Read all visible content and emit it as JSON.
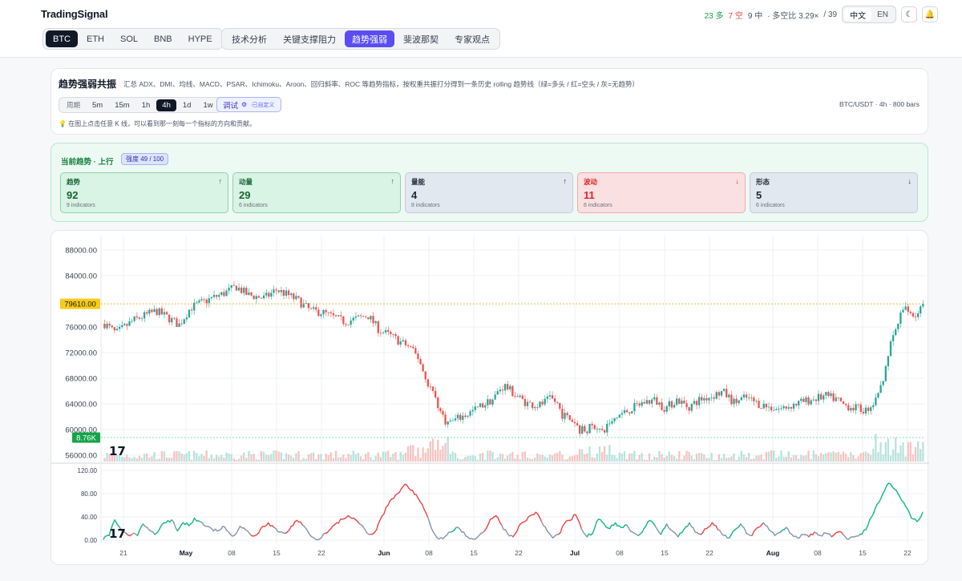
{
  "header": {
    "brand": "TradingSignal",
    "coins": [
      "BTC",
      "ETH",
      "SOL",
      "BNB",
      "HYPE"
    ],
    "active_coin": 0,
    "tabs": [
      "技术分析",
      "关键支撑阻力",
      "趋势强弱",
      "斐波那契",
      "专家观点"
    ],
    "active_tab": 2,
    "stats": {
      "bull": "23 多",
      "bear": "7 空",
      "neutral": "9 中",
      "ratio": "· 多空比 3.29×",
      "total": "/ 39"
    },
    "lang": [
      "中文",
      "EN"
    ],
    "icons": {
      "theme": "moon-icon",
      "alerts": "bell-icon"
    }
  },
  "info": {
    "title": "趋势强弱共振",
    "description": "汇总 ADX、DMI、均线、MACD、PSAR、Ichimoku、Aroon、回归斜率、ROC 等趋势指标，按权重共振打分得到一条历史 rolling 趋势线（绿=多头 / 红=空头 / 灰=无趋势）",
    "period_label": "周期",
    "timeframes": [
      "5m",
      "15m",
      "1h",
      "4h",
      "1d",
      "1w"
    ],
    "active_timeframe": 3,
    "debug_label": "调试",
    "debug_note": "·已自定义",
    "pair_info": "BTC/USDT · 4h · 800 bars",
    "hint": "💡 在图上点击任意 K 线，可以看到那一刻每一个指标的方向和贡献。"
  },
  "trend": {
    "title": "当前趋势 · 上行",
    "strength": "强度 49 / 100",
    "metrics": [
      {
        "name": "趋势",
        "value": "92",
        "sub": "9 indicators",
        "arrow": "↑",
        "tone": "green"
      },
      {
        "name": "动量",
        "value": "29",
        "sub": "6 indicators",
        "arrow": "↑",
        "tone": "green"
      },
      {
        "name": "量能",
        "value": "4",
        "sub": "8 indicators",
        "arrow": "↑",
        "tone": "gray"
      },
      {
        "name": "波动",
        "value": "11",
        "sub": "6 indicators",
        "arrow": "↓",
        "tone": "red"
      },
      {
        "name": "形态",
        "value": "5",
        "sub": "6 indicators",
        "arrow": "↓",
        "tone": "gray"
      }
    ]
  },
  "chart_data": {
    "type": "candlestick",
    "price_axis": {
      "ticks": [
        "88000.00",
        "84000.00",
        "76000.00",
        "72000.00",
        "68000.00",
        "64000.00",
        "60000.00",
        "56000.00"
      ],
      "range": [
        55000,
        89500
      ]
    },
    "last_price_label": "79610.00",
    "last_price": 79610,
    "volume_label": "8.76K",
    "indicator_axis": {
      "ticks": [
        "120.00",
        "80.00",
        "40.00",
        "0.00"
      ],
      "range": [
        -8,
        128
      ]
    },
    "x_ticks": [
      "21",
      "May",
      "08",
      "15",
      "22",
      "Jun",
      "08",
      "15",
      "22",
      "Jul",
      "08",
      "15",
      "22",
      "Aug",
      "08",
      "15",
      "22"
    ],
    "price_path": [
      [
        0,
        76500
      ],
      [
        2,
        75000
      ],
      [
        5,
        77000
      ],
      [
        9,
        78500
      ],
      [
        11,
        77500
      ],
      [
        13,
        76300
      ],
      [
        15,
        79000
      ],
      [
        18,
        80200
      ],
      [
        21,
        81300
      ],
      [
        23,
        82300
      ],
      [
        25,
        81000
      ],
      [
        28,
        80500
      ],
      [
        30,
        81800
      ],
      [
        32,
        81000
      ],
      [
        34,
        80000
      ],
      [
        36,
        78500
      ],
      [
        38,
        78300
      ],
      [
        40,
        77500
      ],
      [
        42,
        76800
      ],
      [
        44,
        77300
      ],
      [
        46,
        77800
      ],
      [
        48,
        75500
      ],
      [
        50,
        74600
      ],
      [
        52,
        73500
      ],
      [
        53,
        73000
      ],
      [
        55,
        71000
      ],
      [
        56,
        68000
      ],
      [
        57,
        66500
      ],
      [
        58,
        64500
      ],
      [
        59,
        62000
      ],
      [
        60,
        61000
      ],
      [
        62,
        61800
      ],
      [
        64,
        62700
      ],
      [
        66,
        63800
      ],
      [
        68,
        64800
      ],
      [
        69,
        66300
      ],
      [
        70,
        66800
      ],
      [
        72,
        65200
      ],
      [
        74,
        64000
      ],
      [
        76,
        63800
      ],
      [
        78,
        64800
      ],
      [
        79,
        64200
      ],
      [
        80,
        62300
      ],
      [
        82,
        61300
      ],
      [
        83,
        60000
      ],
      [
        84,
        60000
      ],
      [
        86,
        60700
      ],
      [
        87,
        59200
      ],
      [
        88,
        61000
      ],
      [
        90,
        62300
      ],
      [
        92,
        63200
      ],
      [
        94,
        64200
      ],
      [
        96,
        64600
      ],
      [
        98,
        63300
      ],
      [
        100,
        64700
      ],
      [
        102,
        63500
      ],
      [
        104,
        64700
      ],
      [
        106,
        65200
      ],
      [
        108,
        65900
      ],
      [
        110,
        64200
      ],
      [
        112,
        65000
      ],
      [
        114,
        64100
      ],
      [
        116,
        63500
      ],
      [
        118,
        63200
      ],
      [
        120,
        63800
      ],
      [
        122,
        64300
      ],
      [
        124,
        64800
      ],
      [
        126,
        65200
      ],
      [
        128,
        64700
      ],
      [
        129,
        63900
      ],
      [
        131,
        63400
      ],
      [
        133,
        63000
      ],
      [
        134,
        63900
      ],
      [
        135,
        64600
      ],
      [
        136,
        68000
      ],
      [
        137,
        72200
      ],
      [
        138,
        75000
      ],
      [
        139,
        77500
      ],
      [
        140,
        79300
      ],
      [
        141,
        78000
      ],
      [
        142,
        77800
      ],
      [
        143,
        79610
      ]
    ],
    "indicator_path": [
      [
        0,
        2,
        "gray"
      ],
      [
        1,
        8,
        "green"
      ],
      [
        2,
        35,
        "green"
      ],
      [
        3,
        20,
        "green"
      ],
      [
        4,
        12,
        "gray"
      ],
      [
        5,
        10,
        "red"
      ],
      [
        6,
        8,
        "gray"
      ],
      [
        7,
        28,
        "green"
      ],
      [
        8,
        18,
        "gray"
      ],
      [
        9,
        10,
        "gray"
      ],
      [
        10,
        22,
        "green"
      ],
      [
        11,
        30,
        "green"
      ],
      [
        12,
        35,
        "green"
      ],
      [
        13,
        16,
        "gray"
      ],
      [
        14,
        30,
        "green"
      ],
      [
        15,
        25,
        "green"
      ],
      [
        16,
        38,
        "green"
      ],
      [
        17,
        32,
        "green"
      ],
      [
        18,
        24,
        "gray"
      ],
      [
        19,
        20,
        "gray"
      ],
      [
        20,
        16,
        "gray"
      ],
      [
        21,
        24,
        "gray"
      ],
      [
        22,
        14,
        "gray"
      ],
      [
        23,
        8,
        "gray"
      ],
      [
        24,
        24,
        "gray"
      ],
      [
        25,
        18,
        "gray"
      ],
      [
        26,
        8,
        "gray"
      ],
      [
        27,
        10,
        "red"
      ],
      [
        28,
        24,
        "red"
      ],
      [
        29,
        30,
        "red"
      ],
      [
        30,
        22,
        "red"
      ],
      [
        31,
        14,
        "gray"
      ],
      [
        32,
        12,
        "gray"
      ],
      [
        33,
        24,
        "red"
      ],
      [
        34,
        34,
        "red"
      ],
      [
        35,
        26,
        "red"
      ],
      [
        36,
        14,
        "gray"
      ],
      [
        37,
        4,
        "gray"
      ],
      [
        38,
        2,
        "gray"
      ],
      [
        39,
        12,
        "gray"
      ],
      [
        40,
        20,
        "red"
      ],
      [
        41,
        30,
        "red"
      ],
      [
        42,
        36,
        "red"
      ],
      [
        43,
        42,
        "red"
      ],
      [
        44,
        38,
        "red"
      ],
      [
        45,
        28,
        "red"
      ],
      [
        46,
        18,
        "gray"
      ],
      [
        47,
        10,
        "gray"
      ],
      [
        48,
        18,
        "red"
      ],
      [
        49,
        42,
        "red"
      ],
      [
        50,
        60,
        "red"
      ],
      [
        51,
        72,
        "red"
      ],
      [
        52,
        82,
        "red"
      ],
      [
        53,
        96,
        "red"
      ],
      [
        54,
        86,
        "red"
      ],
      [
        55,
        78,
        "red"
      ],
      [
        56,
        62,
        "red"
      ],
      [
        57,
        40,
        "red"
      ],
      [
        58,
        14,
        "gray"
      ],
      [
        59,
        2,
        "gray"
      ],
      [
        60,
        6,
        "gray"
      ],
      [
        61,
        14,
        "gray"
      ],
      [
        62,
        22,
        "green"
      ],
      [
        63,
        14,
        "gray"
      ],
      [
        64,
        6,
        "gray"
      ],
      [
        65,
        2,
        "gray"
      ],
      [
        66,
        8,
        "gray"
      ],
      [
        67,
        16,
        "gray"
      ],
      [
        68,
        36,
        "red"
      ],
      [
        69,
        42,
        "red"
      ],
      [
        70,
        26,
        "red"
      ],
      [
        71,
        12,
        "gray"
      ],
      [
        72,
        6,
        "gray"
      ],
      [
        73,
        24,
        "red"
      ],
      [
        74,
        32,
        "red"
      ],
      [
        75,
        42,
        "red"
      ],
      [
        76,
        48,
        "red"
      ],
      [
        77,
        32,
        "red"
      ],
      [
        78,
        16,
        "gray"
      ],
      [
        79,
        4,
        "gray"
      ],
      [
        80,
        10,
        "gray"
      ],
      [
        81,
        28,
        "red"
      ],
      [
        82,
        34,
        "red"
      ],
      [
        83,
        44,
        "red"
      ],
      [
        84,
        20,
        "red"
      ],
      [
        85,
        6,
        "gray"
      ],
      [
        86,
        12,
        "green"
      ],
      [
        87,
        36,
        "green"
      ],
      [
        88,
        28,
        "green"
      ],
      [
        89,
        20,
        "green"
      ],
      [
        90,
        30,
        "green"
      ],
      [
        91,
        22,
        "green"
      ],
      [
        92,
        26,
        "green"
      ],
      [
        93,
        14,
        "gray"
      ],
      [
        94,
        8,
        "gray"
      ],
      [
        95,
        20,
        "green"
      ],
      [
        96,
        34,
        "green"
      ],
      [
        97,
        24,
        "green"
      ],
      [
        98,
        10,
        "gray"
      ],
      [
        99,
        28,
        "green"
      ],
      [
        100,
        16,
        "gray"
      ],
      [
        101,
        6,
        "gray"
      ],
      [
        102,
        18,
        "green"
      ],
      [
        103,
        30,
        "green"
      ],
      [
        104,
        14,
        "gray"
      ],
      [
        105,
        10,
        "gray"
      ],
      [
        106,
        20,
        "red"
      ],
      [
        107,
        30,
        "red"
      ],
      [
        108,
        18,
        "red"
      ],
      [
        109,
        8,
        "gray"
      ],
      [
        110,
        4,
        "gray"
      ],
      [
        111,
        18,
        "green"
      ],
      [
        112,
        28,
        "green"
      ],
      [
        113,
        12,
        "gray"
      ],
      [
        114,
        8,
        "gray"
      ],
      [
        115,
        22,
        "red"
      ],
      [
        116,
        30,
        "red"
      ],
      [
        117,
        18,
        "gray"
      ],
      [
        118,
        8,
        "gray"
      ],
      [
        119,
        14,
        "gray"
      ],
      [
        120,
        22,
        "green"
      ],
      [
        121,
        10,
        "gray"
      ],
      [
        122,
        4,
        "gray"
      ],
      [
        123,
        10,
        "gray"
      ],
      [
        124,
        6,
        "gray"
      ],
      [
        125,
        14,
        "red"
      ],
      [
        126,
        8,
        "gray"
      ],
      [
        127,
        12,
        "gray"
      ],
      [
        128,
        6,
        "gray"
      ],
      [
        129,
        14,
        "red"
      ],
      [
        130,
        10,
        "red"
      ],
      [
        131,
        2,
        "gray"
      ],
      [
        132,
        6,
        "gray"
      ],
      [
        133,
        10,
        "gray"
      ],
      [
        134,
        18,
        "green"
      ],
      [
        135,
        40,
        "green"
      ],
      [
        136,
        62,
        "green"
      ],
      [
        137,
        80,
        "green"
      ],
      [
        138,
        98,
        "green"
      ],
      [
        139,
        88,
        "green"
      ],
      [
        140,
        74,
        "green"
      ],
      [
        141,
        58,
        "green"
      ],
      [
        142,
        38,
        "green"
      ],
      [
        143,
        32,
        "green"
      ],
      [
        144,
        48,
        "green"
      ]
    ],
    "colors": {
      "up": "#26a69a",
      "down": "#ef5350",
      "green": "#10b981",
      "red": "#ef4444",
      "gray": "#8896ab",
      "price_line": "#f59e0b"
    }
  }
}
